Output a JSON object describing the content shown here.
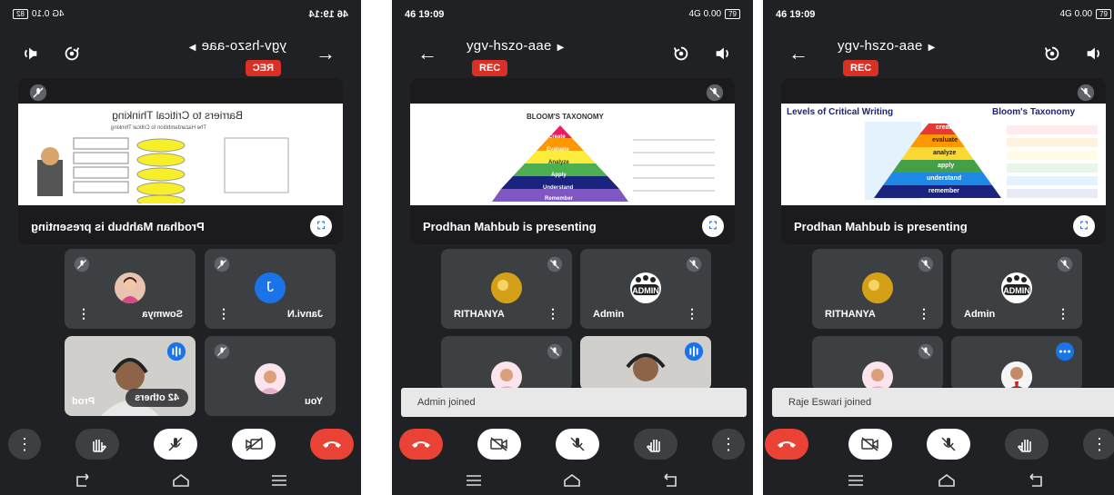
{
  "phones": [
    {
      "status_left": "46 19:14",
      "status_right": "4G 0.10",
      "battery": "82",
      "meeting_code": "ygv-hszo-aae",
      "rec_label": "REC",
      "presenting_text": "Prodhan Mahbub is presenting",
      "slide_title": "Barriers to Critical Thinking",
      "slide_subtitle": "The Hazardambition to Critical Thinking",
      "participants": [
        {
          "name": "Sowmya"
        },
        {
          "name": "Janvi.N",
          "initial": "J"
        },
        {
          "name": "Prod",
          "extra": "42 others"
        },
        {
          "name": "You"
        }
      ]
    },
    {
      "status_left": "46 19:09",
      "status_right": "4G 0.00",
      "battery": "79",
      "meeting_code": "ygv-hszo-aae",
      "rec_label": "REC",
      "presenting_text": "Prodhan Mahbub is presenting",
      "slide_title": "BLOOM'S TAXONOMY",
      "pyramid": [
        "Create",
        "Evaluate",
        "Analyze",
        "Apply",
        "Understand",
        "Remember"
      ],
      "participants": [
        {
          "name": "RITHANYA"
        },
        {
          "name": "Admin"
        }
      ],
      "toast": "Admin joined"
    },
    {
      "status_left": "46 19:09",
      "status_right": "4G 0.00",
      "battery": "79",
      "meeting_code": "ygv-hszo-aae",
      "rec_label": "REC",
      "presenting_text": "Prodhan Mahbub is presenting",
      "slide_title_left": "Levels of Critical Writing",
      "slide_title_right": "Bloom's Taxonomy",
      "pyramid": [
        "create",
        "evaluate",
        "analyze",
        "apply",
        "understand",
        "remember"
      ],
      "participants": [
        {
          "name": "RITHANYA"
        },
        {
          "name": "Admin"
        }
      ],
      "toast": "Raje Eswari joined"
    }
  ],
  "colors": {
    "bg": "#202124",
    "tile": "#3c4043",
    "rec": "#d93025",
    "end_call": "#ea4335",
    "accent": "#1a73e8"
  }
}
